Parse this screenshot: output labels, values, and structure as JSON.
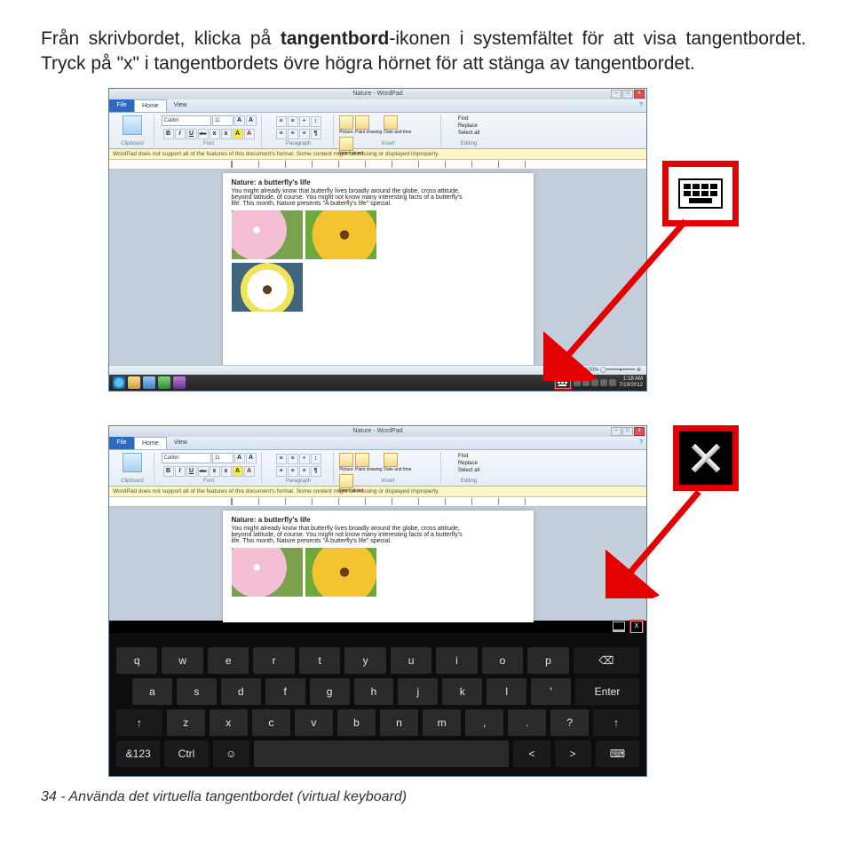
{
  "instruction": {
    "pre": "Från skrivbordet, klicka på ",
    "bold": "tangentbord",
    "post": "-ikonen i systemfältet för att visa tangentbordet. Tryck på \"x\" i tangentbordets övre högra hörnet för att stänga av tangentbordet."
  },
  "wordpad": {
    "title": "Nature - WordPad",
    "file_tab": "File",
    "tab_home": "Home",
    "tab_view": "View",
    "font_name": "Calibri",
    "font_size": "11",
    "fmt_b": "B",
    "fmt_i": "I",
    "fmt_u": "U",
    "fmt_s": "abc",
    "group_clipboard": "Clipboard",
    "group_font": "Font",
    "group_paragraph": "Paragraph",
    "group_insert": "Insert",
    "group_editing": "Editing",
    "insert_picture": "Picture",
    "insert_paint": "Paint drawing",
    "insert_date": "Date and time",
    "insert_object": "Insert object",
    "edit_find": "Find",
    "edit_replace": "Replace",
    "edit_select": "Select all",
    "infobar": "WordPad does not support all of the features of this document's format. Some content might be missing or displayed improperly.",
    "doc_title": "Nature: a butterfly's life",
    "doc_line1": "You might already know that butterfly lives broadly around the globe, cross attitude,",
    "doc_line2": "beyond latitude, of course. You might not know many interesting facts of a butterfly's",
    "doc_line3": "life. This month, Nature presents \"A butterfly's life\" special.",
    "zoom": "100%",
    "help": "?"
  },
  "taskbar": {
    "time": "1:18 AM",
    "date": "7/19/2012"
  },
  "osk": {
    "row1": [
      "q",
      "w",
      "e",
      "r",
      "t",
      "y",
      "u",
      "i",
      "o",
      "p"
    ],
    "backspace_glyph": "⌫",
    "row2": [
      "a",
      "s",
      "d",
      "f",
      "g",
      "h",
      "j",
      "k",
      "l",
      "'"
    ],
    "enter": "Enter",
    "shift_glyph": "↑",
    "row3": [
      "z",
      "x",
      "c",
      "v",
      "b",
      "n",
      "m",
      ",",
      ".",
      "?"
    ],
    "numkey": "&123",
    "ctrl": "Ctrl",
    "smile": "☺",
    "left": "<",
    "right": ">",
    "kbd_glyph": "⌨",
    "close_glyph": "x"
  },
  "footer": "34 - Använda det virtuella tangentbordet (virtual keyboard)"
}
